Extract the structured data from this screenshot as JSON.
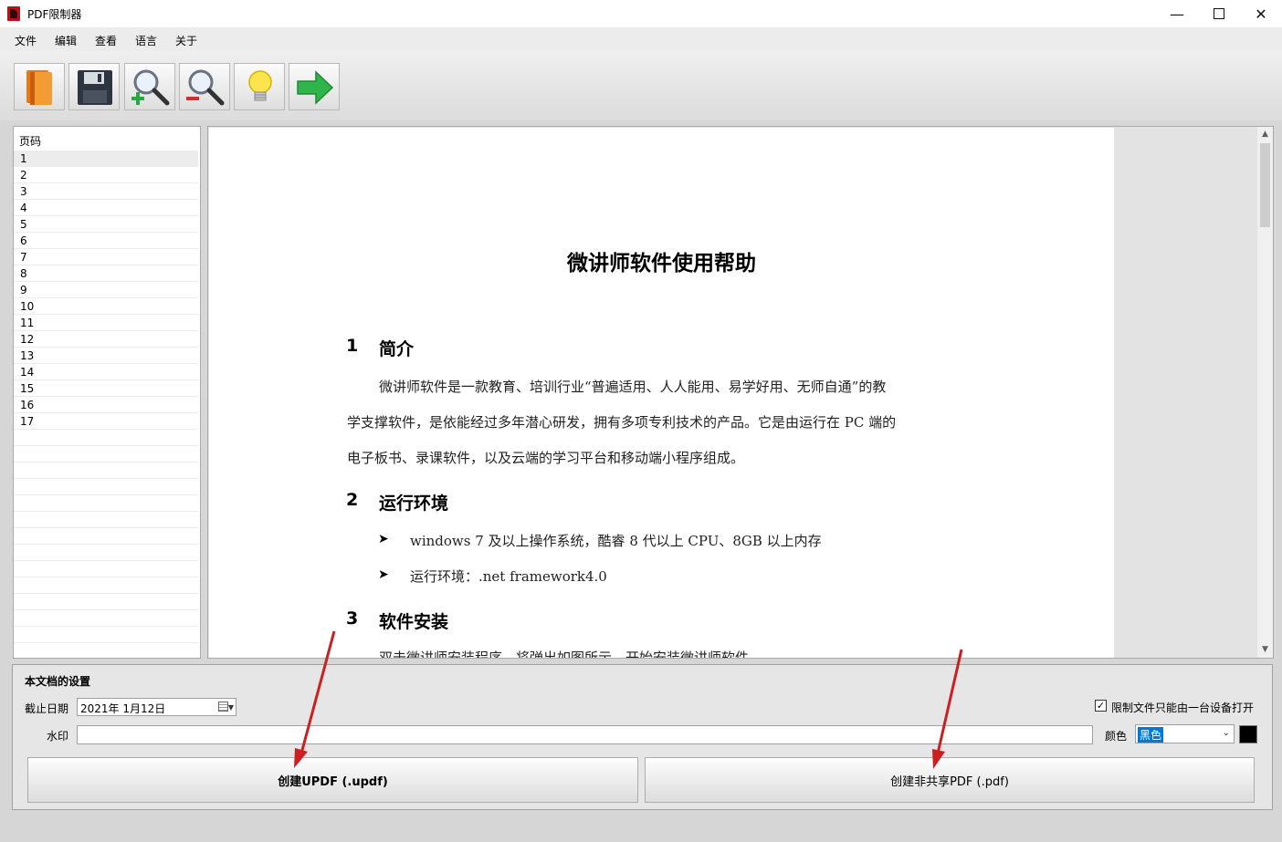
{
  "window": {
    "title": "PDF限制器"
  },
  "menu": {
    "items": [
      "文件",
      "编辑",
      "查看",
      "语言",
      "关于"
    ]
  },
  "toolbar": {
    "buttons": [
      "open-book",
      "save",
      "zoom-in",
      "zoom-out",
      "bulb",
      "next-arrow"
    ]
  },
  "page_list": {
    "header": "页码",
    "pages": [
      "1",
      "2",
      "3",
      "4",
      "5",
      "6",
      "7",
      "8",
      "9",
      "10",
      "11",
      "12",
      "13",
      "14",
      "15",
      "16",
      "17"
    ],
    "selected": "1"
  },
  "document": {
    "title": "微讲师软件使用帮助",
    "sections": [
      {
        "num": "1",
        "title": "简介"
      },
      {
        "num": "2",
        "title": "运行环境"
      },
      {
        "num": "3",
        "title": "软件安装"
      }
    ],
    "intro_lines": [
      "微讲师软件是一款教育、培训行业“普遍适用、人人能用、易学好用、无师自通”的教",
      "学支撑软件，是依能经过多年潜心研发，拥有多项专利技术的产品。它是由运行在 PC 端的",
      "电子板书、录课软件，以及云端的学习平台和移动端小程序组成。"
    ],
    "env_items": [
      "windows 7 及以上操作系统，酷睿 8 代以上 CPU、8GB 以上内存",
      "运行环境：.net framework4.0"
    ],
    "install_line": "双击微讲师安装程序，将弹出如图所示，开始安装微讲师软件。"
  },
  "settings": {
    "title": "本文档的设置",
    "date_label": "截止日期",
    "date_value": "2021年  1月12日",
    "device_limit_label": "限制文件只能由一台设备打开",
    "device_limit_checked": true,
    "watermark_label": "水印",
    "watermark_value": "",
    "color_label": "颜色",
    "color_value": "黑色",
    "swatch_color": "#000000"
  },
  "actions": {
    "create_updf": "创建UPDF (.updf)",
    "create_pdf": "创建非共享PDF (.pdf)"
  }
}
